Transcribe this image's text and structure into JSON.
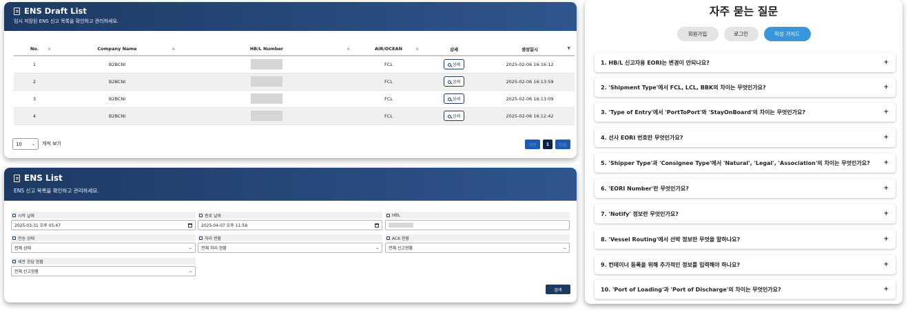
{
  "draft": {
    "title": "ENS Draft List",
    "subtitle": "임시 저장된 ENS 신고 목록을 확인하고 관리하세요.",
    "columns": [
      "No.",
      "Company Name",
      "HB/L Number",
      "AIR/OCEAN",
      "상세",
      "생성일시"
    ],
    "rows": [
      {
        "no": "1",
        "company": "B2BCNI",
        "mode": "FCL",
        "detail": "상세",
        "created": "2025-02-06 16:16:12"
      },
      {
        "no": "2",
        "company": "B2BCNI",
        "mode": "FCL",
        "detail": "상세",
        "created": "2025-02-06 16:13:59"
      },
      {
        "no": "3",
        "company": "B2BCNI",
        "mode": "FCL",
        "detail": "상세",
        "created": "2025-02-06 16:13:09"
      },
      {
        "no": "4",
        "company": "B2BCNI",
        "mode": "FCL",
        "detail": "상세",
        "created": "2025-02-06 16:12:42"
      }
    ],
    "page_size": "10",
    "page_size_label": "개씩 보기",
    "pager": {
      "prev": "이전",
      "current": "1",
      "next": "다음"
    }
  },
  "ens": {
    "title": "ENS List",
    "subtitle": "ENS 신고 목록을 확인하고 관리하세요.",
    "fields": {
      "start": {
        "label": "시작 날짜",
        "value": "2025-03-31 오후 05:47"
      },
      "end": {
        "label": "종료 날짜",
        "value": "2025-04-07 오후 11:59"
      },
      "hbl": {
        "label": "HBL",
        "value": ""
      },
      "send": {
        "label": "전송 상태",
        "value": "전체 상태"
      },
      "process": {
        "label": "처리 현황",
        "value": "전체 처리 현황"
      },
      "ack": {
        "label": "ACK 현황",
        "value": "전체 신고현황"
      },
      "customs": {
        "label": "세관 응답 현황",
        "value": "전체 신고현황"
      }
    },
    "search_label": "검색"
  },
  "faq": {
    "title": "자주 묻는 질문",
    "tabs": [
      "회원가입",
      "로그인",
      "작성 가이드"
    ],
    "active_tab": "작성 가이드",
    "items": [
      "1. HB/L 신고자용 EORI는 변경이 안되나요?",
      "2. 'Shipment Type'에서 FCL, LCL, BBK의 차이는 무엇인가요?",
      "3. 'Type of Entry'에서 'PortToPort'와 'StayOnBoard'의 차이는 무엇인가요?",
      "4. 선사 EORI 번호란 무엇인가요?",
      "5. 'Shipper Type'과 'Consignee Type'에서 'Natural', 'Legal', 'Association'의 차이는 무엇인가요?",
      "6. 'EORI Number'란 무엇인가요?",
      "7. 'Notify' 정보란 무엇인가요?",
      "8. 'Vessel Routing'에서 선박 정보란 무엇을 말하나요?",
      "9. 컨테이너 등록을 위해 추가적인 정보를 입력해야 하나요?",
      "10. 'Port of Loading'과 'Port of Discharge'의 차이는 무엇인가요?"
    ],
    "expand_symbol": "+"
  }
}
